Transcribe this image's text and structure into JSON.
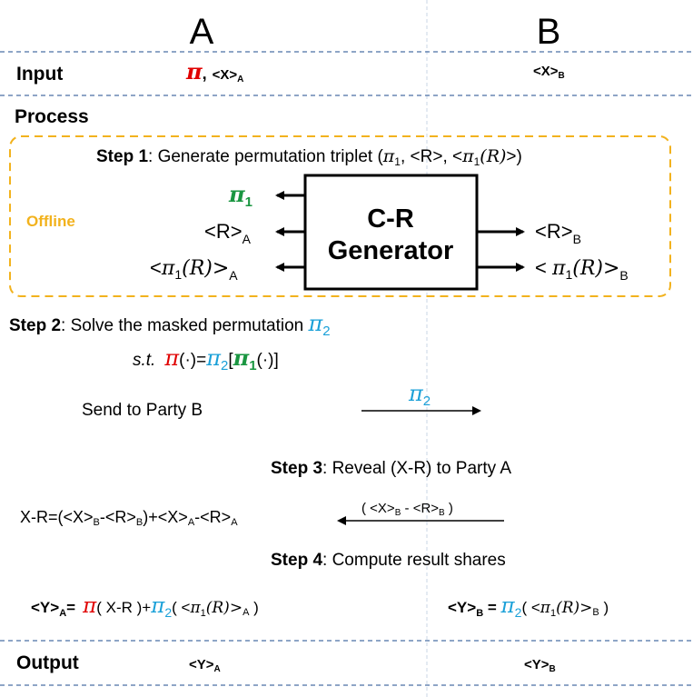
{
  "columns": {
    "a": "A",
    "b": "B"
  },
  "rows": {
    "input_label": "Input",
    "process_label": "Process",
    "output_label": "Output"
  },
  "symbols": {
    "pi": "π",
    "pi1": "π",
    "pi2": "π",
    "sub1": "1",
    "sub2": "2"
  },
  "colors": {
    "pi": "#e00000",
    "pi1": "#1a9641",
    "pi2": "#1aa0d8",
    "offline": "#f2b21d",
    "dash_line": "#4a6fa5",
    "divider": "#c8d4e6"
  },
  "input": {
    "a_sep": ",",
    "a_share": "<X>",
    "a_share_sub": "A",
    "b_share": "<X>",
    "b_share_sub": "B"
  },
  "offline_label": "Offline",
  "step1": {
    "label": "Step 1",
    "text": ": Generate permutation triplet (",
    "r_part": ", <R>, <",
    "pi1_of_r": "(R)",
    "close": ">)"
  },
  "generator": {
    "line1": "C-R",
    "line2": "Generator"
  },
  "gen_outputs": {
    "left_r": "<R>",
    "left_r_sub": "A",
    "left_pr_open": "<",
    "left_pr_arg": "(R)>",
    "left_pr_sub": "A",
    "right_r": "<R>",
    "right_r_sub": "B",
    "right_pr_open": "< ",
    "right_pr_arg": "(R)>",
    "right_pr_sub": "B"
  },
  "step2": {
    "label": "Step 2",
    "text": ": Solve the masked permutation ",
    "st": "s.t.",
    "eq_arg": "(·)=",
    "eq_bracket_open": "[",
    "eq_inner": "(·)]",
    "send": "Send to Party B"
  },
  "step3": {
    "label": "Step 3",
    "text": ": Reveal (X-R) to Party A",
    "formula": "X-R=(<X>",
    "f_b1": "B",
    "f_mid1": "-<R>",
    "f_b2": "B",
    "f_mid2": ")+<X>",
    "f_a1": "A",
    "f_mid3": "-<R>",
    "f_a2": "A",
    "msg_open": "( <X>",
    "msg_b1": "B",
    "msg_mid": " - <R>",
    "msg_b2": "B",
    "msg_close": " )"
  },
  "step4": {
    "label": "Step 4",
    "text": ": Compute result shares",
    "ya": "<Y>",
    "ya_sub": "A",
    "ya_eq": "=",
    "ya_arg": "( X-R )+",
    "ya_paren": "( <",
    "ya_pr": "(R)>",
    "ya_end_sub": "A",
    "ya_close": " )",
    "yb": "<Y>",
    "yb_sub": "B",
    "yb_eq": " = ",
    "yb_paren": "( <",
    "yb_pr": "(R)>",
    "yb_end_sub": "B",
    "yb_close": " )"
  },
  "output": {
    "a_share": "<Y>",
    "a_sub": "A",
    "b_share": "<Y>",
    "b_sub": "B"
  }
}
